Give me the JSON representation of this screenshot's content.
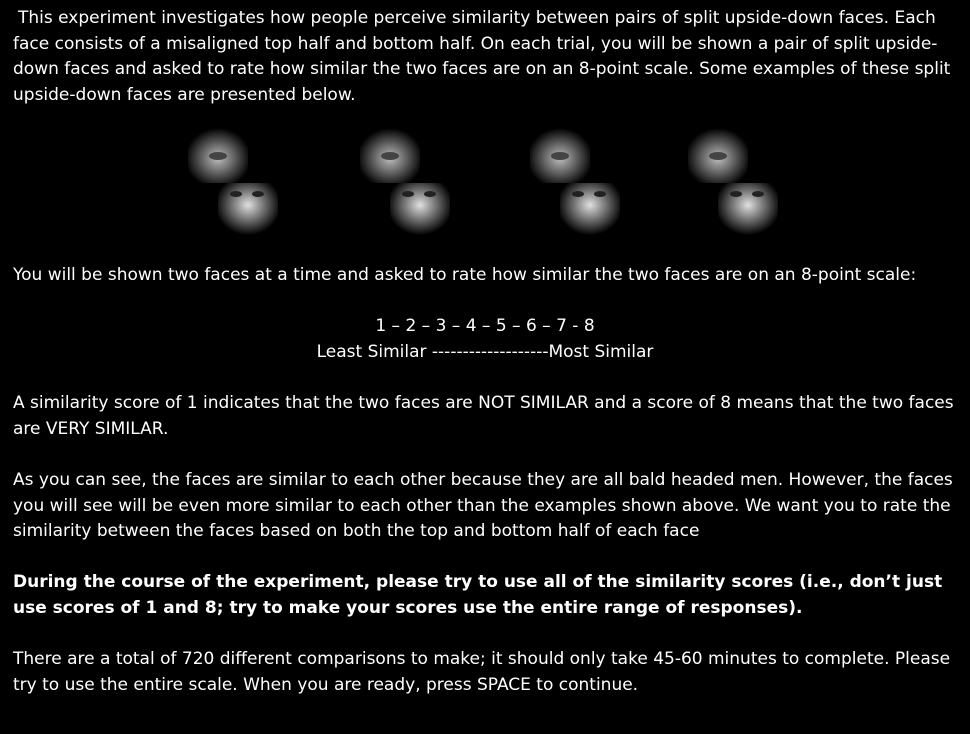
{
  "intro": "This experiment investigates how people perceive similarity between pairs of split upside-down faces. Each face consists of a misaligned top half and bottom half. On each trial, you will be shown a pair of split upside-down faces and asked to rate how similar the two faces are on an 8-point scale. Some examples of these split upside-down faces are presented below.",
  "faces_examples": [
    "split-face-1",
    "split-face-2",
    "split-face-3",
    "split-face-4"
  ],
  "scale_intro": "You will be shown two faces at a time and asked to rate how similar the two faces are on an 8-point scale:",
  "scale_numbers": "1 – 2 – 3 – 4 – 5 – 6 – 7 - 8",
  "scale_labels": "Least Similar -------------------Most  Similar",
  "explanation": "A similarity score of 1 indicates that the two faces are NOT SIMILAR and a score of 8 means that the two faces are VERY SIMILAR.",
  "faces_note": "As you can see, the faces are similar to each other because they are all bald headed men. However, the faces you will see will be even more similar to each other than the examples shown above. We want you to rate the similarity between the faces based on both the top and bottom half of each face",
  "bold_instruction": "During the course of the experiment, please try to use all of the similarity scores (i.e., don’t just use scores of 1 and 8; try to make your scores use the entire range of responses).",
  "closing": "There are a total of 720 different comparisons to make; it should only take 45-60 minutes to complete. Please try to use the entire scale. When you are ready, press SPACE to continue."
}
